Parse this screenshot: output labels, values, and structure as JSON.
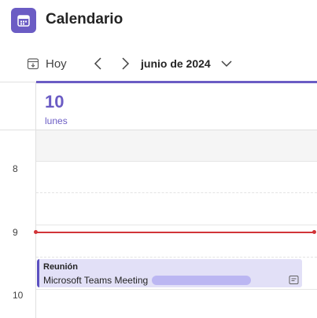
{
  "app": {
    "title": "Calendario",
    "icon": "calendar-icon",
    "accent": "#6b5cc4"
  },
  "toolbar": {
    "today_label": "Hoy",
    "today_icon": "calendar-today-icon",
    "prev_icon": "chevron-left-icon",
    "next_icon": "chevron-right-icon",
    "month_label": "junio de 2024",
    "dropdown_icon": "chevron-down-icon"
  },
  "day": {
    "number": "10",
    "name": "lunes"
  },
  "hours": [
    "8",
    "9",
    "10"
  ],
  "current_time_color": "#d13438",
  "event": {
    "title": "Reunión",
    "subtitle": "Microsoft Teams Meeting",
    "icon": "teams-meeting-icon",
    "color": "#e2e0f7"
  }
}
